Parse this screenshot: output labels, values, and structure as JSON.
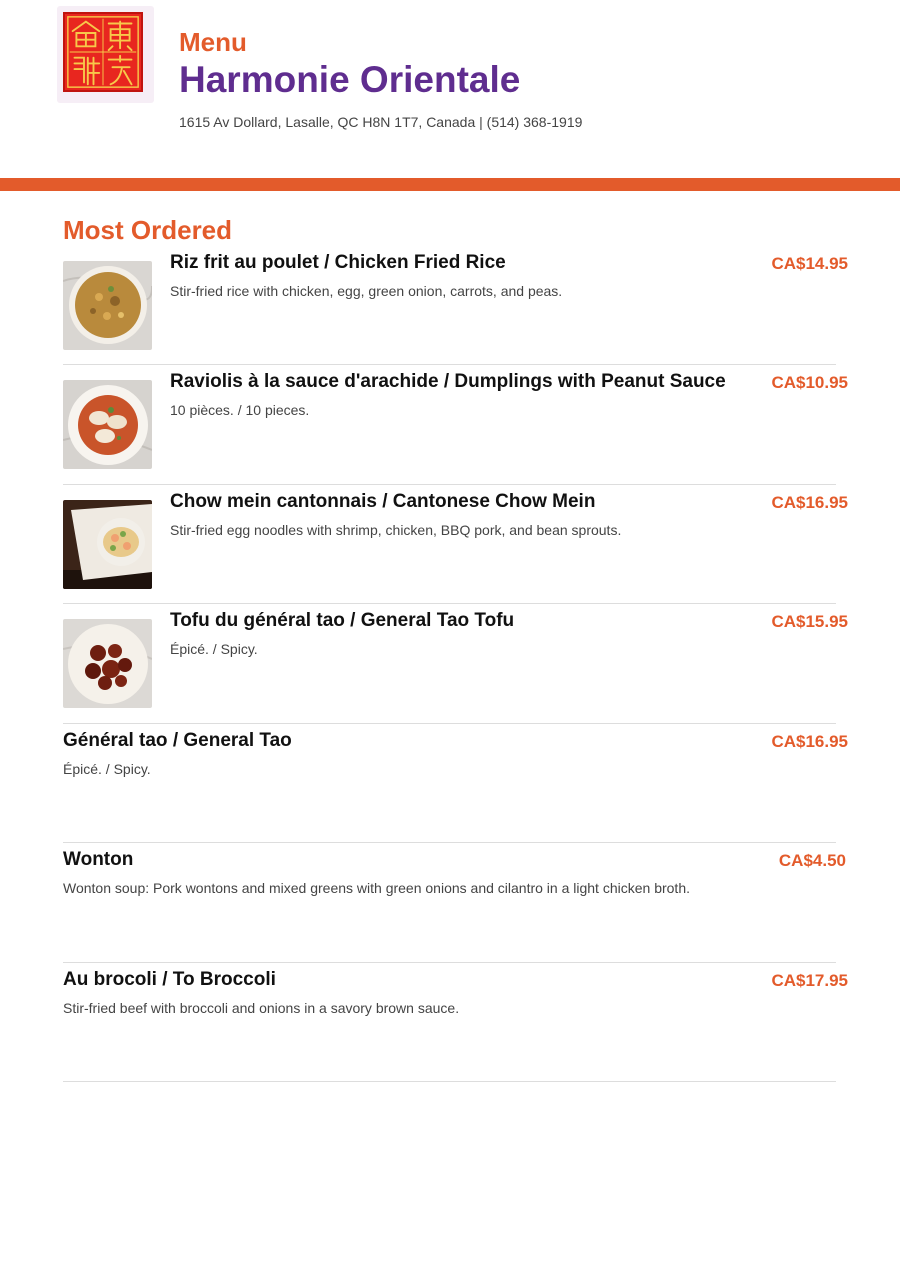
{
  "header": {
    "menu_label": "Menu",
    "restaurant_name": "Harmonie Orientale",
    "address": "1615 Av Dollard, Lasalle, QC H8N 1T7, Canada | (514) 368-1919",
    "logo_glyphs": "東方食軒"
  },
  "colors": {
    "accent": "#e35b2b",
    "brand": "#5f2d8f",
    "seal": "#e8261f"
  },
  "section": {
    "title": "Most Ordered"
  },
  "items": [
    {
      "name": "Riz frit au poulet / Chicken Fried Rice",
      "description": "Stir-fried rice with chicken, egg, green onion, carrots, and peas.",
      "price": "CA$14.95",
      "image": "fried-rice-image"
    },
    {
      "name": "Raviolis à la sauce d'arachide / Dumplings with Peanut Sauce",
      "description": "10 pièces. / 10 pieces.",
      "price": "CA$10.95",
      "image": "dumplings-image"
    },
    {
      "name": "Chow mein cantonnais / Cantonese Chow Mein",
      "description": "Stir-fried egg noodles with shrimp, chicken, BBQ pork, and bean sprouts.",
      "price": "CA$16.95",
      "image": "chow-mein-image"
    },
    {
      "name": "Tofu du général tao / General Tao Tofu",
      "description": "Épicé. / Spicy.",
      "price": "CA$15.95",
      "image": "general-tao-tofu-image"
    },
    {
      "name": "Général tao / General Tao",
      "description": "Épicé. / Spicy.",
      "price": "CA$16.95"
    },
    {
      "name": "Wonton",
      "description": "Wonton soup: Pork wontons and mixed greens with green onions and cilantro in a light chicken broth.",
      "price": "CA$4.50"
    },
    {
      "name": "Au brocoli / To Broccoli",
      "description": "Stir-fried beef with broccoli and onions in a savory brown sauce.",
      "price": "CA$17.95"
    }
  ]
}
